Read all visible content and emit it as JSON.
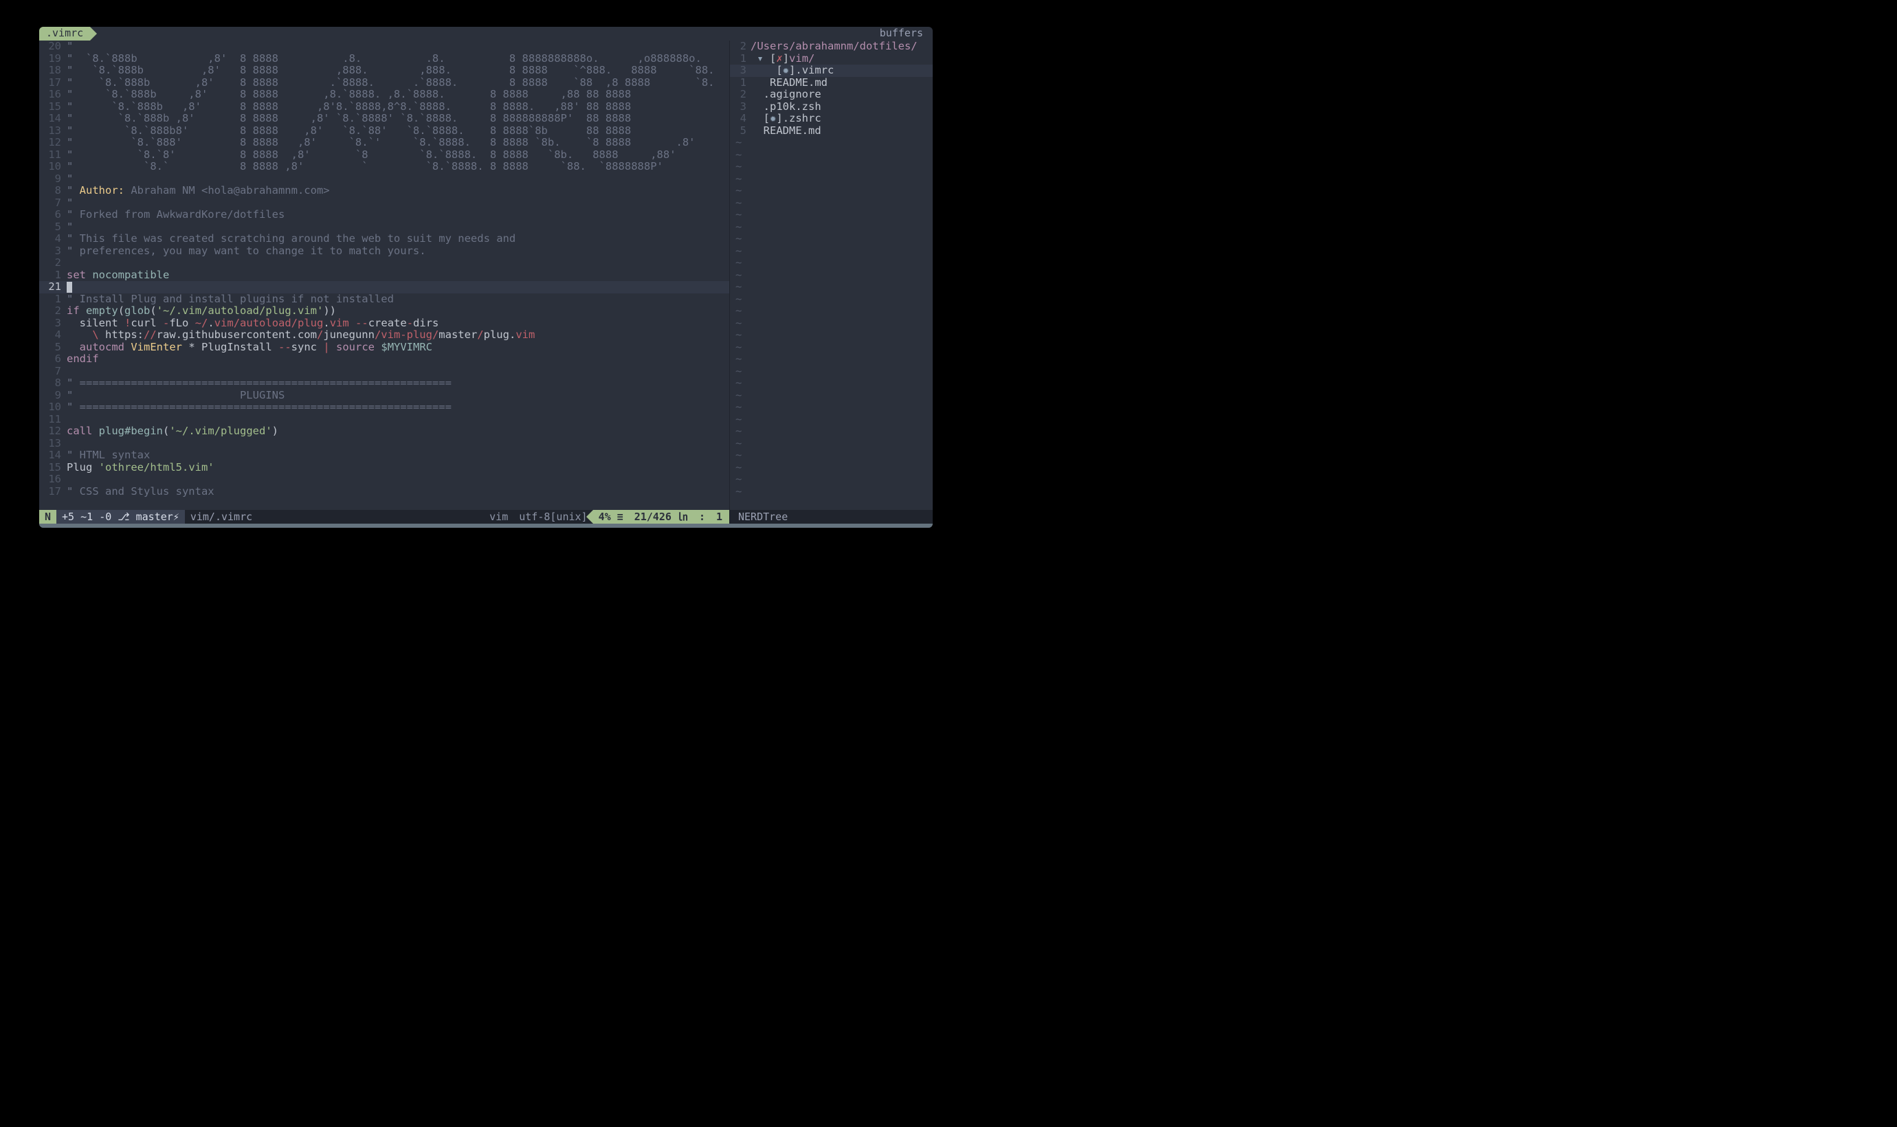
{
  "topbar": {
    "left_tab": ".vimrc",
    "right_tab": "buffers"
  },
  "editor": {
    "lines": [
      {
        "n": "20",
        "seg": [
          {
            "c": "c-comment",
            "t": "\" "
          }
        ]
      },
      {
        "n": "19",
        "seg": [
          {
            "c": "c-comment",
            "t": "\"  `8.`888b           ,8'  8 8888          .8.          .8.          8 8888888888o.      ,o888888o."
          }
        ]
      },
      {
        "n": "18",
        "seg": [
          {
            "c": "c-comment",
            "t": "\"   `8.`888b         ,8'   8 8888         ,888.        ,888.         8 8888    `^888.   8888     `88."
          }
        ]
      },
      {
        "n": "17",
        "seg": [
          {
            "c": "c-comment",
            "t": "\"    `8.`888b       ,8'    8 8888        .`8888.      .`8888.        8 8888    `88  ,8 8888       `8."
          }
        ]
      },
      {
        "n": "16",
        "seg": [
          {
            "c": "c-comment",
            "t": "\"     `8.`888b     ,8'     8 8888       ,8.`8888. ,8.`8888.       8 8888     ,88 88 8888"
          }
        ]
      },
      {
        "n": "15",
        "seg": [
          {
            "c": "c-comment",
            "t": "\"      `8.`888b   ,8'      8 8888      ,8'8.`8888,8^8.`8888.      8 8888.   ,88' 88 8888"
          }
        ]
      },
      {
        "n": "14",
        "seg": [
          {
            "c": "c-comment",
            "t": "\"       `8.`888b ,8'       8 8888     ,8' `8.`8888' `8.`8888.     8 888888888P'  88 8888"
          }
        ]
      },
      {
        "n": "13",
        "seg": [
          {
            "c": "c-comment",
            "t": "\"        `8.`888b8'        8 8888    ,8'   `8.`88'   `8.`8888.    8 8888`8b      88 8888"
          }
        ]
      },
      {
        "n": "12",
        "seg": [
          {
            "c": "c-comment",
            "t": "\"         `8.`888'         8 8888   ,8'     `8.`'     `8.`8888.   8 8888 `8b.    `8 8888       .8'"
          }
        ]
      },
      {
        "n": "11",
        "seg": [
          {
            "c": "c-comment",
            "t": "\"          `8.`8'          8 8888  ,8'       `8        `8.`8888.  8 8888   `8b.   8888     ,88'"
          }
        ]
      },
      {
        "n": "10",
        "seg": [
          {
            "c": "c-comment",
            "t": "\"           `8.`           8 8888 ,8'         `         `8.`8888. 8 8888     `88.  `8888888P'"
          }
        ]
      },
      {
        "n": "9",
        "seg": [
          {
            "c": "c-comment",
            "t": "\""
          }
        ]
      },
      {
        "n": "8",
        "seg": [
          {
            "c": "c-comment",
            "t": "\" "
          },
          {
            "c": "c-yellow",
            "t": "Author:"
          },
          {
            "c": "c-comment",
            "t": " Abraham NM <hola@abrahamnm.com>"
          }
        ]
      },
      {
        "n": "7",
        "seg": [
          {
            "c": "c-comment",
            "t": "\""
          }
        ]
      },
      {
        "n": "6",
        "seg": [
          {
            "c": "c-comment",
            "t": "\" Forked from AwkwardKore/dotfiles"
          }
        ]
      },
      {
        "n": "5",
        "seg": [
          {
            "c": "c-comment",
            "t": "\""
          }
        ]
      },
      {
        "n": "4",
        "seg": [
          {
            "c": "c-comment",
            "t": "\" This file was created scratching around the web to suit my needs and"
          }
        ]
      },
      {
        "n": "3",
        "seg": [
          {
            "c": "c-comment",
            "t": "\" preferences, you may want to change it to match yours."
          }
        ]
      },
      {
        "n": "2",
        "seg": []
      },
      {
        "n": "1",
        "seg": [
          {
            "c": "c-key",
            "t": "set"
          },
          {
            "c": "c-fg",
            "t": " "
          },
          {
            "c": "c-cyan",
            "t": "nocompatible"
          }
        ]
      },
      {
        "n": "21",
        "active": true,
        "cursor": true,
        "seg": []
      },
      {
        "n": "1",
        "seg": [
          {
            "c": "c-comment",
            "t": "\" Install Plug and install plugins if not installed"
          }
        ]
      },
      {
        "n": "2",
        "seg": [
          {
            "c": "c-key",
            "t": "if"
          },
          {
            "c": "c-fg",
            "t": " "
          },
          {
            "c": "c-cyan",
            "t": "empty"
          },
          {
            "c": "c-fg",
            "t": "("
          },
          {
            "c": "c-cyan",
            "t": "glob"
          },
          {
            "c": "c-fg",
            "t": "("
          },
          {
            "c": "c-str",
            "t": "'~/.vim/autoload/plug.vim'"
          },
          {
            "c": "c-fg",
            "t": "))"
          }
        ]
      },
      {
        "n": "3",
        "seg": [
          {
            "c": "c-fg",
            "t": "  silent "
          },
          {
            "c": "c-ident",
            "t": "!"
          },
          {
            "c": "c-fg",
            "t": "curl "
          },
          {
            "c": "c-ident",
            "t": "-"
          },
          {
            "c": "c-fg",
            "t": "fLo "
          },
          {
            "c": "c-ident",
            "t": "~/"
          },
          {
            "c": "c-fg",
            "t": "."
          },
          {
            "c": "c-ident",
            "t": "vim/autoload/plug"
          },
          {
            "c": "c-fg",
            "t": "."
          },
          {
            "c": "c-ident",
            "t": "vim"
          },
          {
            "c": "c-fg",
            "t": " "
          },
          {
            "c": "c-ident",
            "t": "--"
          },
          {
            "c": "c-fg",
            "t": "create"
          },
          {
            "c": "c-ident",
            "t": "-"
          },
          {
            "c": "c-fg",
            "t": "dirs"
          }
        ]
      },
      {
        "n": "4",
        "seg": [
          {
            "c": "c-fg",
            "t": "    "
          },
          {
            "c": "c-ident",
            "t": "\\"
          },
          {
            "c": "c-fg",
            "t": " https:"
          },
          {
            "c": "c-ident",
            "t": "//"
          },
          {
            "c": "c-fg",
            "t": "raw.githubusercontent.com"
          },
          {
            "c": "c-ident",
            "t": "/"
          },
          {
            "c": "c-fg",
            "t": "junegunn"
          },
          {
            "c": "c-ident",
            "t": "/vim-plug/"
          },
          {
            "c": "c-fg",
            "t": "master"
          },
          {
            "c": "c-ident",
            "t": "/"
          },
          {
            "c": "c-fg",
            "t": "plug."
          },
          {
            "c": "c-ident",
            "t": "vim"
          }
        ]
      },
      {
        "n": "5",
        "seg": [
          {
            "c": "c-fg",
            "t": "  "
          },
          {
            "c": "c-key",
            "t": "autocmd"
          },
          {
            "c": "c-fg",
            "t": " "
          },
          {
            "c": "c-yellow",
            "t": "VimEnter"
          },
          {
            "c": "c-fg",
            "t": " * "
          },
          {
            "c": "c-fg",
            "t": "PlugInstall "
          },
          {
            "c": "c-ident",
            "t": "--"
          },
          {
            "c": "c-fg",
            "t": "sync "
          },
          {
            "c": "c-ident",
            "t": "|"
          },
          {
            "c": "c-fg",
            "t": " "
          },
          {
            "c": "c-key",
            "t": "source"
          },
          {
            "c": "c-fg",
            "t": " "
          },
          {
            "c": "c-cyan",
            "t": "$MYVIMRC"
          }
        ]
      },
      {
        "n": "6",
        "seg": [
          {
            "c": "c-key",
            "t": "endif"
          }
        ]
      },
      {
        "n": "7",
        "seg": []
      },
      {
        "n": "8",
        "seg": [
          {
            "c": "c-comment",
            "t": "\" =========================================================="
          }
        ]
      },
      {
        "n": "9",
        "seg": [
          {
            "c": "c-comment",
            "t": "\"                          PLUGINS"
          }
        ]
      },
      {
        "n": "10",
        "seg": [
          {
            "c": "c-comment",
            "t": "\" =========================================================="
          }
        ]
      },
      {
        "n": "11",
        "seg": []
      },
      {
        "n": "12",
        "seg": [
          {
            "c": "c-key",
            "t": "call"
          },
          {
            "c": "c-fg",
            "t": " "
          },
          {
            "c": "c-cyan",
            "t": "plug#begin"
          },
          {
            "c": "c-fg",
            "t": "("
          },
          {
            "c": "c-str",
            "t": "'~/.vim/plugged'"
          },
          {
            "c": "c-fg",
            "t": ")"
          }
        ]
      },
      {
        "n": "13",
        "seg": []
      },
      {
        "n": "14",
        "seg": [
          {
            "c": "c-comment",
            "t": "\" HTML syntax"
          }
        ]
      },
      {
        "n": "15",
        "seg": [
          {
            "c": "c-fg",
            "t": "Plug "
          },
          {
            "c": "c-str",
            "t": "'othree/html5.vim'"
          }
        ]
      },
      {
        "n": "16",
        "seg": []
      },
      {
        "n": "17",
        "seg": [
          {
            "c": "c-comment",
            "t": "\" CSS and Stylus syntax"
          }
        ]
      }
    ]
  },
  "tree": {
    "lines": [
      {
        "n": "2",
        "seg": [
          {
            "c": "c-key",
            "t": "/Users/abrahamnm/dotfiles/"
          }
        ]
      },
      {
        "n": "1",
        "seg": [
          {
            "c": "c-fg",
            "t": " "
          },
          {
            "c": "c-blue",
            "t": "▾ "
          },
          {
            "c": "c-fg",
            "t": "["
          },
          {
            "c": "c-ident",
            "t": "✗"
          },
          {
            "c": "c-fg",
            "t": "]"
          },
          {
            "c": "c-key",
            "t": "vim/"
          }
        ]
      },
      {
        "n": "3",
        "active": true,
        "seg": [
          {
            "c": "c-fg",
            "t": "    ["
          },
          {
            "c": "c-blue",
            "t": "✹"
          },
          {
            "c": "c-fg",
            "t": "]"
          },
          {
            "c": "c-fg",
            "t": ".vimrc"
          }
        ]
      },
      {
        "n": "1",
        "seg": [
          {
            "c": "c-fg",
            "t": "   README.md"
          }
        ]
      },
      {
        "n": "2",
        "seg": [
          {
            "c": "c-fg",
            "t": "  .agignore"
          }
        ]
      },
      {
        "n": "3",
        "seg": [
          {
            "c": "c-fg",
            "t": "  .p10k.zsh"
          }
        ]
      },
      {
        "n": "4",
        "seg": [
          {
            "c": "c-fg",
            "t": "  ["
          },
          {
            "c": "c-blue",
            "t": "✹"
          },
          {
            "c": "c-fg",
            "t": "]"
          },
          {
            "c": "c-fg",
            "t": ".zshrc"
          }
        ]
      },
      {
        "n": "5",
        "seg": [
          {
            "c": "c-fg",
            "t": "  README.md"
          }
        ]
      }
    ],
    "tilde_count": 30
  },
  "status": {
    "mode": "N",
    "git": "+5 ~1 -0 ⎇ master⚡",
    "file": "vim/.vimrc",
    "filetype": "vim",
    "encoding": "utf-8[unix]",
    "percent": "4% ≡",
    "position": "21/426 ㏑",
    "col_label": ":",
    "col": "1",
    "right_label": "NERDTree"
  }
}
